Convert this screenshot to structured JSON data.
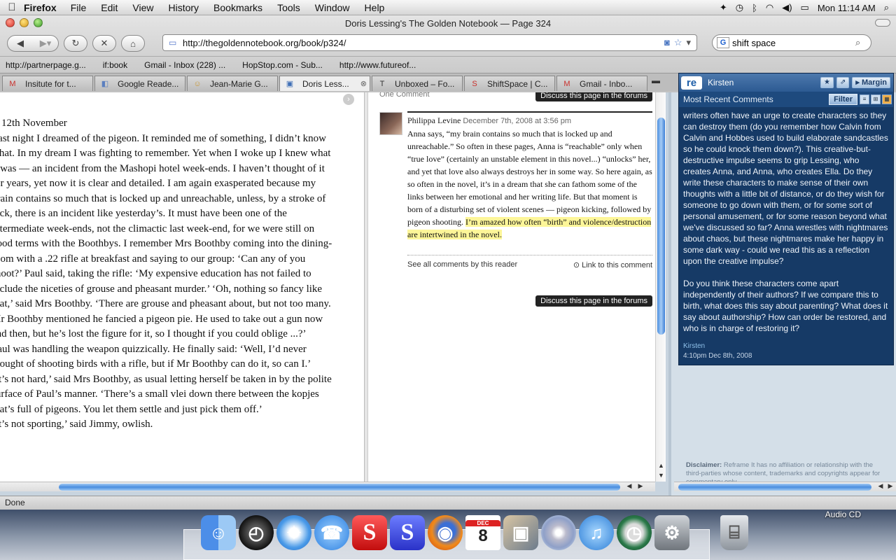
{
  "menubar": {
    "apple": "",
    "app": "Firefox",
    "items": [
      "File",
      "Edit",
      "View",
      "History",
      "Bookmarks",
      "Tools",
      "Window",
      "Help"
    ],
    "clock": "Mon 11:14 AM"
  },
  "window": {
    "title": "Doris Lessing's The Golden Notebook — Page 324"
  },
  "toolbar": {
    "url": "http://thegoldennotebook.org/book/p324/",
    "search_value": "shift space",
    "search_engine": "G"
  },
  "bookmarks": [
    "http://partnerpage.g...",
    "if:book",
    "Gmail - Inbox (228) ...",
    "HopStop.com - Sub...",
    "http://www.futureof..."
  ],
  "tabs": [
    {
      "label": "Insitute for t...",
      "fav": "M",
      "color": "#c9302c"
    },
    {
      "label": "Google Reade...",
      "fav": "◧",
      "color": "#5b7fbf"
    },
    {
      "label": "Jean-Marie G...",
      "fav": "☺",
      "color": "#c99a3a"
    },
    {
      "label": "Doris Less...",
      "fav": "▣",
      "color": "#3f6fb6",
      "active": true
    },
    {
      "label": "Unboxed – Fo...",
      "fav": "T",
      "color": "#333333"
    },
    {
      "label": "ShiftSpace | C...",
      "fav": "S",
      "color": "#c9302c"
    },
    {
      "label": "Gmail - Inbo...",
      "fav": "M",
      "color": "#c9302c"
    }
  ],
  "book": {
    "dateline": "12th November",
    "paragraphs": [
      "Last night I dreamed of the pigeon. It reminded me of something, I didn’t know what. In my dream I was fighting to remember. Yet when I woke up I knew what it was — an incident from the Mashopi hotel week-ends. I haven’t thought of it for years, yet now it is clear and detailed. I am again exasperated because my brain contains so much that is locked up and unreachable, unless, by a stroke of luck, there is an incident like yesterday’s. It must have been one of the intermediate week-ends, not the climactic last week-end, for we were still on good terms with the Boothbys. I remember Mrs Boothby coming into the dining-room with a .22 rifle at breakfast and saying to our group: ‘Can any of you shoot?’ Paul said, taking the rifle: ‘My expensive education has not failed to include the niceties of grouse and pheasant murder.’ ‘Oh, nothing so fancy like that,’ said Mrs Boothby. ‘There are grouse and pheasant about, but not too many. Mr Boothby mentioned he fancied a pigeon pie. He used to take out a gun now and then, but he’s lost the figure for it, so I thought if you could oblige ...?’",
      "Paul was handling the weapon quizzically. He finally said: ‘Well, I’d never thought of shooting birds with a rifle, but if Mr Boothby can do it, so can I.’",
      "‘It’s not hard,’ said Mrs Boothby, as usual letting herself be taken in by the polite surface of Paul’s manner. ‘There’s a small vlei down there between the kopjes that’s full of pigeons. You let them settle and just pick them off.’",
      "‘It’s not sporting,’ said Jimmy, owlish."
    ]
  },
  "comments": {
    "count_label": "One Comment",
    "discuss_label": "Discuss this page in the forums",
    "author": "Philippa Levine",
    "date": "December 7th, 2008 at 3:56 pm",
    "body": "Anna says, “my brain contains so much that is locked up and unreachable.” So often in these pages, Anna is “reachable” only when “true love” (certainly an unstable element in this novel...) “unlocks” her, and yet that love also always destroys her in some way. So here again, as so often in the novel, it’s in a dream that she can fathom some of the links between her emotional and her writing life. But that moment is born of a disturbing set of violent scenes — pigeon kicking, followed by pigeon shooting.",
    "highlight": "I’m amazed how often “birth” and violence/destruction are intertwined in the novel.",
    "see_all": "See all comments by this reader",
    "link": "Link to this comment"
  },
  "sidebar": {
    "logo": "re",
    "user": "Kirsten",
    "margin_label": "Margin",
    "section_title": "Most Recent Comments",
    "filter_label": "Filter",
    "paragraphs": [
      "writers often have an urge to create characters so they can destroy them (do you remember how Calvin from Calvin and Hobbes used to build elaborate sandcastles so he could knock them down?). This creative-but-destructive impulse seems to grip Lessing, who creates Anna, and Anna, who creates Ella. Do they write these characters to make sense of their own thoughts with a little bit of distance, or do they wish for someone to go down with them, or for some sort of personal amusement, or for some reason beyond what we've discussed so far? Anna wrestles with nightmares about chaos, but these nightmares make her happy in some dark way - could we read this as a reflection upon the creative impulse?",
      "Do you think these characters come apart independently of their authors? If we compare this to birth, what does this say about parenting? What does it say about authorship? How can order be restored, and who is in charge of restoring it?"
    ],
    "comment_author": "Kirsten",
    "comment_date": "4:10pm Dec 8th, 2008",
    "disclaimer_label": "Disclaimer:",
    "disclaimer": "Reframe It has no affiliation or relationship with the third-parties whose content, trademarks and copyrights appear for commentary only."
  },
  "status": "Done",
  "desktop": {
    "audio_cd": "Audio CD",
    "calendar_month": "DEC",
    "calendar_day": "8"
  }
}
